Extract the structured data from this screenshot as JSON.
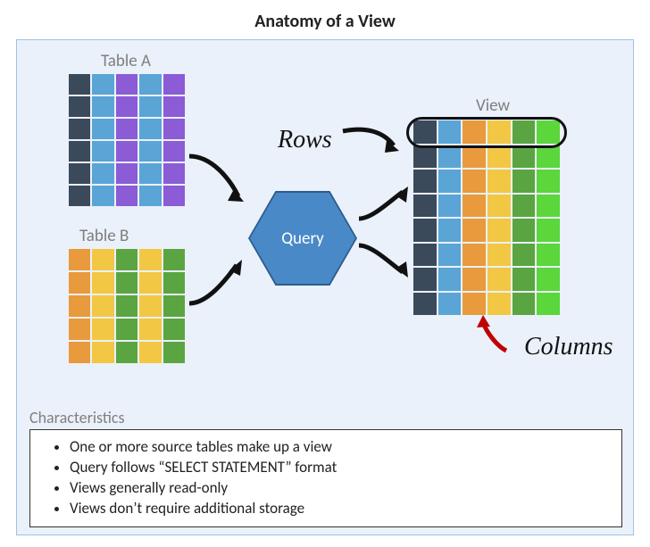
{
  "title": "Anatomy of a View",
  "labels": {
    "tableA": "Table A",
    "tableB": "Table B",
    "view": "View",
    "rows": "Rows",
    "columns": "Columns",
    "query": "Query",
    "characteristics_header": "Characteristics"
  },
  "characteristics": {
    "items": [
      "One or more source tables make up a view",
      "Query follows “SELECT STATEMENT” format",
      "Views generally read-only",
      "Views don’t require additional storage"
    ]
  },
  "colors": {
    "darkblue": "#3b4a5a",
    "skyblue": "#5aa5d6",
    "purple": "#8c5bd6",
    "orange": "#e89a3c",
    "yellow": "#f2c744",
    "green": "#5aa542",
    "lightgreen": "#5bd63b",
    "hexfill": "#4a89c7"
  },
  "chart_data": {
    "type": "table",
    "description": "Conceptual diagram: two source tables (A,B) feed a Query which produces a View. Rows are horizontal slices of the View; Columns are vertical slices.",
    "tableA": {
      "rows": 6,
      "cols": 5,
      "column_colors": [
        "darkblue",
        "skyblue",
        "purple",
        "skyblue",
        "purple"
      ]
    },
    "tableB": {
      "rows": 5,
      "cols": 5,
      "column_colors": [
        "orange",
        "yellow",
        "green",
        "yellow",
        "green"
      ]
    },
    "view": {
      "rows": 8,
      "cols": 6,
      "column_colors": [
        "darkblue",
        "skyblue",
        "orange",
        "yellow",
        "green",
        "lightgreen"
      ]
    }
  }
}
